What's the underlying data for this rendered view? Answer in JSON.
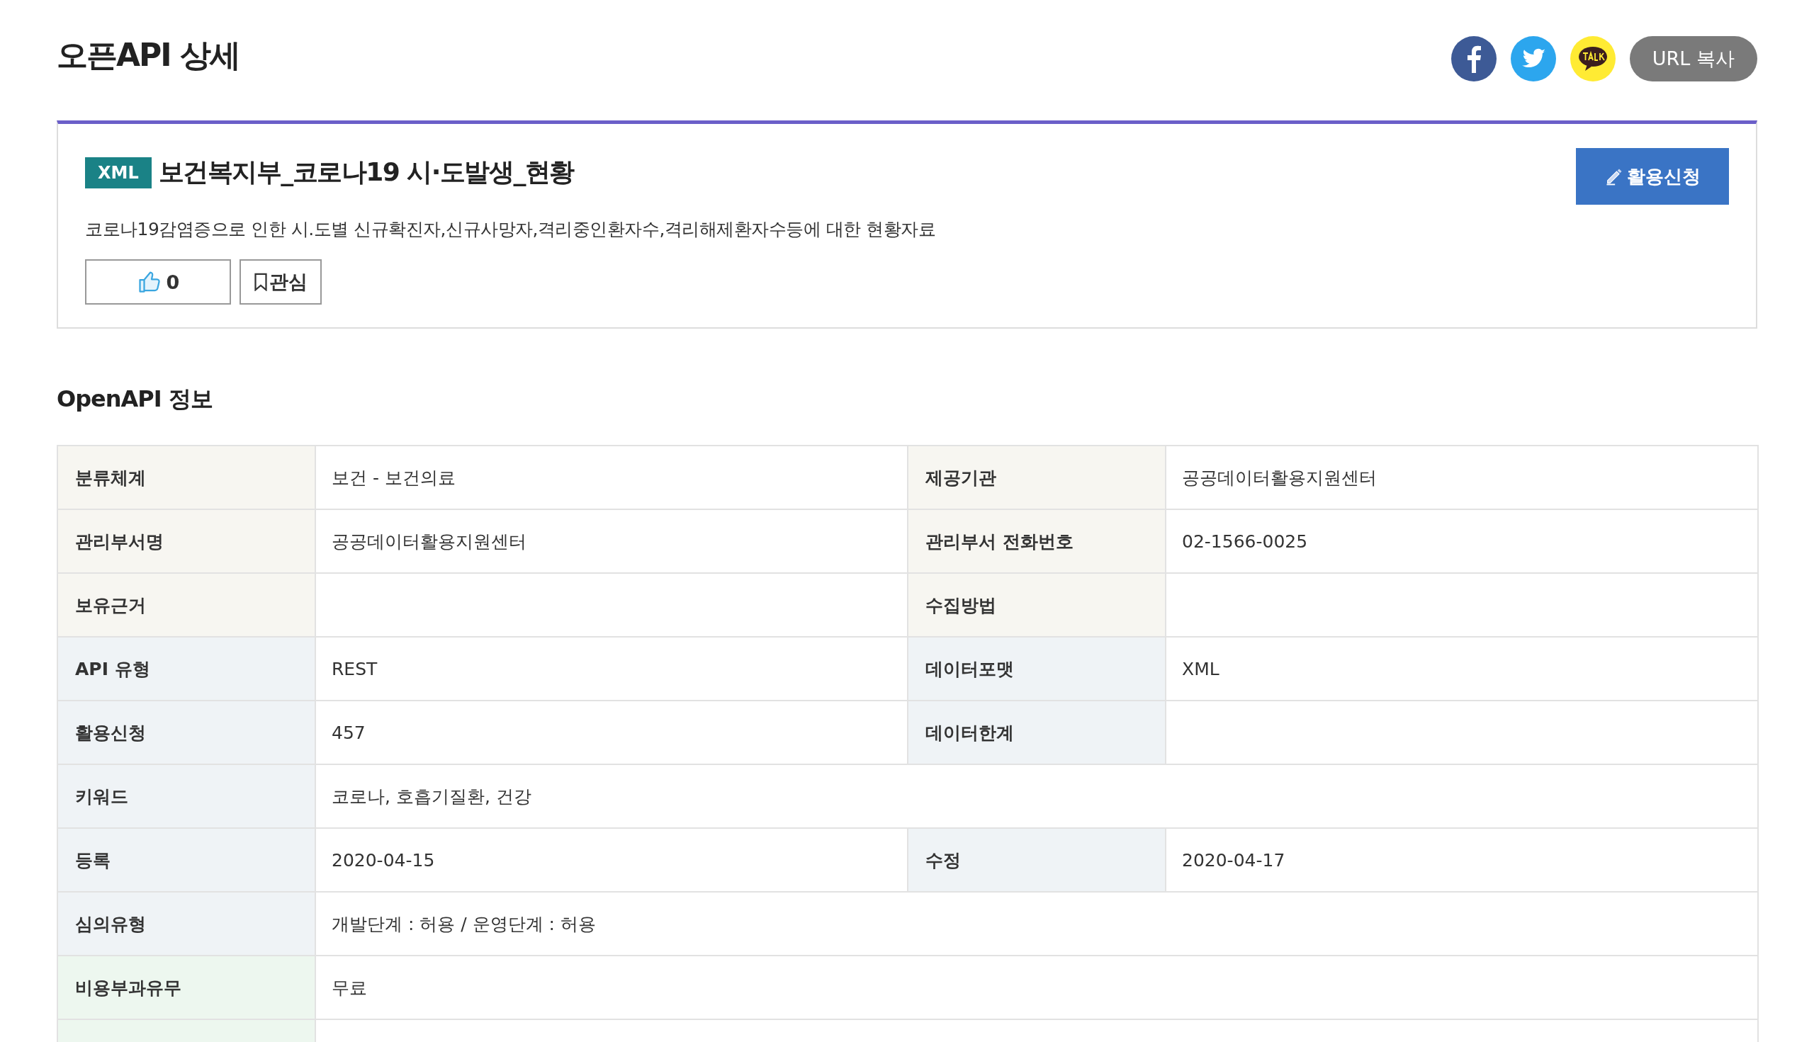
{
  "page_title": "오픈API 상세",
  "share": {
    "url_button": "URL 복사"
  },
  "dataset": {
    "format_badge": "XML",
    "title": "보건복지부_코로나19 시·도발생_현황",
    "apply_button": "활용신청",
    "description": "코로나19감염증으로 인한 시.도별 신규확진자,신규사망자,격리중인환자수,격리해제환자수등에 대한 현황자료",
    "like_count": "0",
    "bookmark_label": "관심"
  },
  "info": {
    "heading": "OpenAPI 정보",
    "rows": [
      {
        "color": "#f7f6f1",
        "cells": [
          {
            "label": "분류체계",
            "value": "보건 - 보건의료"
          },
          {
            "label": "제공기관",
            "value": "공공데이터활용지원센터"
          }
        ]
      },
      {
        "color": "#f7f6f1",
        "cells": [
          {
            "label": "관리부서명",
            "value": "공공데이터활용지원센터"
          },
          {
            "label": "관리부서 전화번호",
            "value": "02-1566-0025"
          }
        ]
      },
      {
        "color": "#f7f6f1",
        "cells": [
          {
            "label": "보유근거"
          },
          {
            "label": "수집방법"
          }
        ]
      },
      {
        "color": "#eff3f6",
        "cells": [
          {
            "label": "API 유형",
            "value": "REST"
          },
          {
            "label": "데이터포맷",
            "value": "XML"
          }
        ]
      },
      {
        "color": "#eff3f6",
        "cells": [
          {
            "label": "활용신청",
            "value": "457"
          },
          {
            "label": "데이터한계"
          }
        ]
      },
      {
        "color": "#eff3f6",
        "cells": [
          {
            "label": "키워드",
            "value": "코로나, 호흡기질환, 건강"
          }
        ]
      },
      {
        "color": "#eff3f6",
        "cells": [
          {
            "label": "등록",
            "value": "2020-04-15"
          },
          {
            "label": "수정",
            "value": "2020-04-17"
          }
        ]
      },
      {
        "color": "#eff3f6",
        "cells": [
          {
            "label": "심의유형",
            "value": "개발단계 : 허용 / 운영단계 : 허용"
          }
        ]
      },
      {
        "color": "#edf7ef",
        "cells": [
          {
            "label": "비용부과유무",
            "value": "무료"
          }
        ]
      },
      {
        "color": "#edf7ef",
        "cells": [
          {}
        ]
      }
    ]
  }
}
